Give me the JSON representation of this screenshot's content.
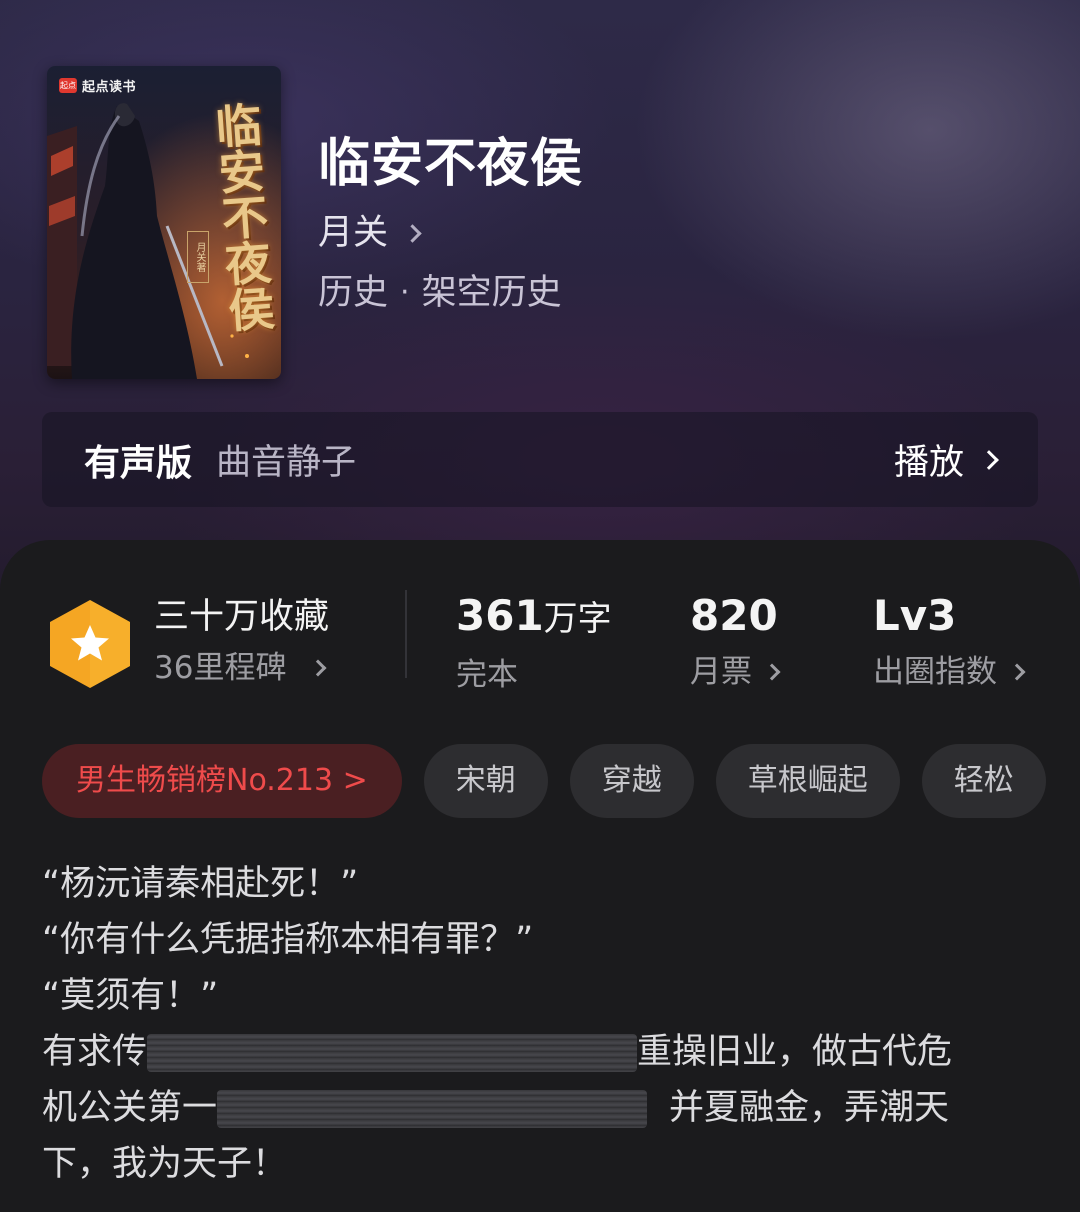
{
  "book": {
    "cover": {
      "brand_badge": "起点",
      "brand": "起点读书",
      "title_art": "临安不夜侯",
      "author_mark": "月关著"
    },
    "title": "临安不夜侯",
    "author": "月关",
    "genre": "历史",
    "subgenre": "架空历史",
    "genre_separator": "·"
  },
  "audio": {
    "label": "有声版",
    "narrator": "曲音静子",
    "play_label": "播放"
  },
  "stats": {
    "collection_title": "三十万收藏",
    "milestone": "36里程碑",
    "word_count_value": "361",
    "word_count_unit": "万字",
    "status": "完本",
    "monthly_votes_value": "820",
    "monthly_votes_label": "月票",
    "level_value": "Lv3",
    "level_label": "出圈指数"
  },
  "tags": [
    {
      "label": "男生畅销榜No.213 >",
      "kind": "rank"
    },
    {
      "label": "宋朝"
    },
    {
      "label": "穿越"
    },
    {
      "label": "草根崛起"
    },
    {
      "label": "轻松"
    }
  ],
  "synopsis": {
    "line1": "“杨沅请秦相赴死！”",
    "line2": "“你有什么凭据指称本相有罪？”",
    "line3": "“莫须有！”",
    "line4_start": "有求传",
    "line4_end": "重操旧业，做古代危",
    "line5_start": "机公关第一",
    "line5_end": "并夏融金，弄潮天",
    "line6": "下，我为天子！"
  },
  "colors": {
    "badge_gold": "#f5a623",
    "rank_red": "#ef4b4b"
  }
}
